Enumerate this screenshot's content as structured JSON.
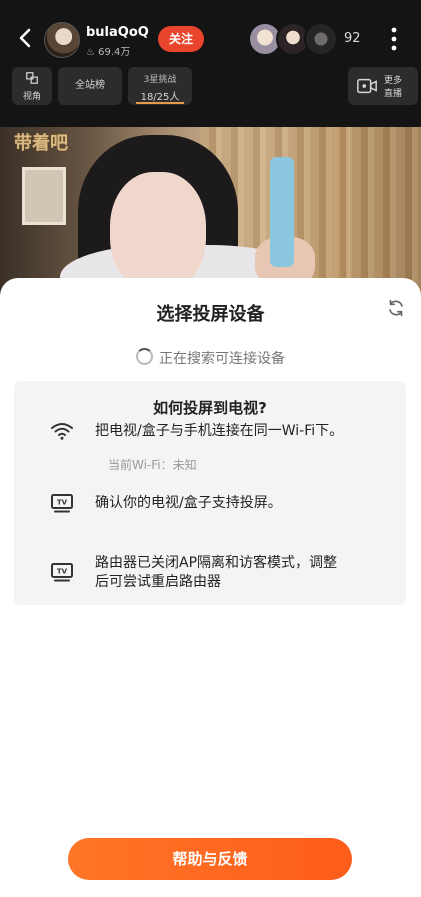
{
  "header": {
    "host_name": "bulaQoQ",
    "host_fans": "69.4万",
    "follow_label": "关注",
    "viewer_count": "92"
  },
  "toolbar": {
    "view_angle_label": "视角",
    "rank_label": "全站榜",
    "challenge_title": "3星挑战",
    "challenge_progress": "18/25人",
    "more_live_label_line1": "更多",
    "more_live_label_line2": "直播"
  },
  "stream": {
    "overlay_text": "带着吧"
  },
  "sheet": {
    "title": "选择投屏设备",
    "searching_text": "正在搜索可连接设备",
    "help": {
      "title": "如何投屏到电视?",
      "step1": "把电视/盒子与手机连接在同一Wi-Fi下。",
      "wifi_label": "当前Wi-Fi：未知",
      "step2": "确认你的电视/盒子支持投屏。",
      "step3_line1": "路由器已关闭AP隔离和访客模式，调整",
      "step3_line2": "后可尝试重启路由器"
    },
    "cta_label": "帮助与反馈"
  },
  "colors": {
    "accent": "#fe5c1a",
    "follow": "#e8452c",
    "card_bg": "#f3f5f5"
  },
  "icons": [
    "back-arrow-icon",
    "view-angle-icon",
    "more-dots-icon",
    "live-camera-icon",
    "refresh-icon",
    "spinner-icon",
    "wifi-icon",
    "tv-icon"
  ]
}
